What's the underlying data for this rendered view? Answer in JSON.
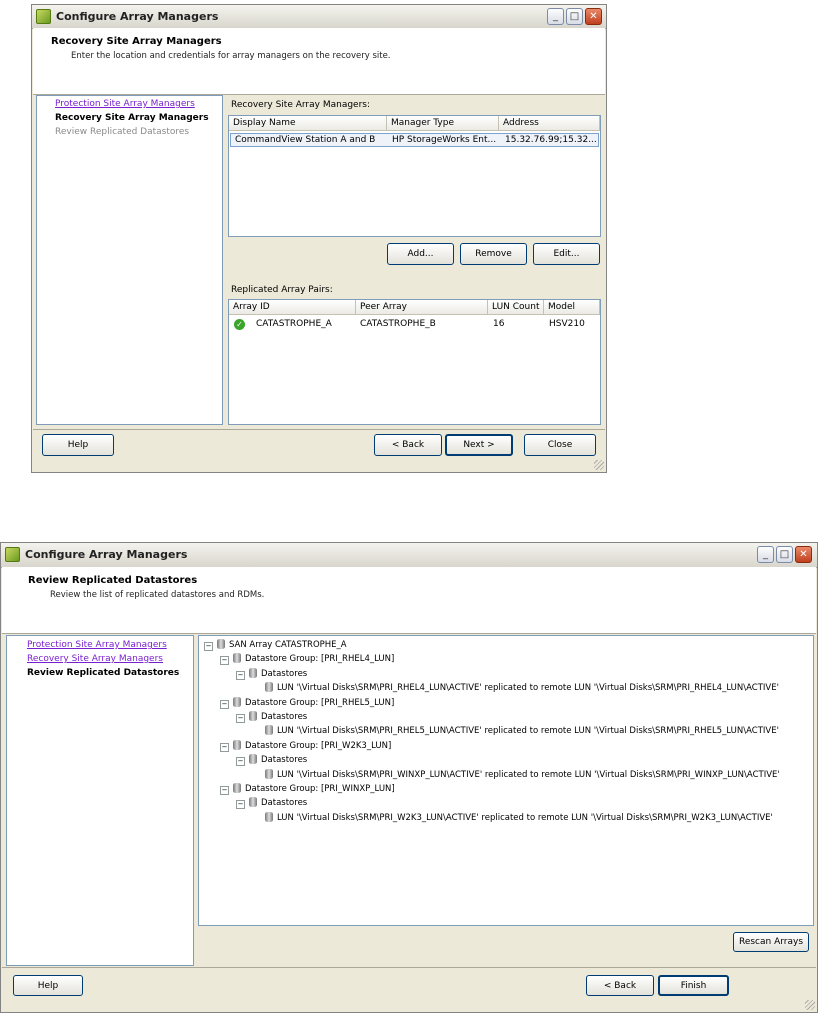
{
  "window1": {
    "title": "Configure Array Managers",
    "header_title": "Recovery Site Array Managers",
    "header_subtitle": "Enter the location and credentials for array managers on the recovery site.",
    "steps": [
      "Protection Site Array Managers",
      "Recovery Site Array Managers",
      "Review Replicated Datastores"
    ],
    "managers_label": "Recovery Site Array Managers:",
    "managers_columns": [
      "Display Name",
      "Manager Type",
      "Address"
    ],
    "managers_rows": [
      [
        "CommandView Station A and B",
        "HP StorageWorks Ent...",
        "15.32.76.99;15.32..."
      ]
    ],
    "add_label": "Add...",
    "remove_label": "Remove",
    "edit_label": "Edit...",
    "pairs_label": "Replicated Array Pairs:",
    "pairs_columns": [
      "Array ID",
      "Peer Array",
      "LUN Count",
      "Model"
    ],
    "pairs_rows": [
      [
        "CATASTROPHE_A",
        "CATASTROPHE_B",
        "16",
        "HSV210"
      ]
    ],
    "help_label": "Help",
    "back_label": "< Back",
    "next_label": "Next >",
    "close_label": "Close"
  },
  "window2": {
    "title": "Configure Array Managers",
    "header_title": "Review Replicated Datastores",
    "header_subtitle": "Review the list of replicated datastores and RDMs.",
    "steps": [
      "Protection Site Array Managers",
      "Recovery Site Array Managers",
      "Review Replicated Datastores"
    ],
    "tree": {
      "root": "SAN Array CATASTROPHE_A",
      "groups": [
        {
          "label": "Datastore Group: [PRI_RHEL4_LUN]",
          "child": "Datastores",
          "lun": "LUN '\\Virtual Disks\\SRM\\PRI_RHEL4_LUN\\ACTIVE' replicated to remote LUN '\\Virtual Disks\\SRM\\PRI_RHEL4_LUN\\ACTIVE'"
        },
        {
          "label": "Datastore Group: [PRI_RHEL5_LUN]",
          "child": "Datastores",
          "lun": "LUN '\\Virtual Disks\\SRM\\PRI_RHEL5_LUN\\ACTIVE' replicated to remote LUN '\\Virtual Disks\\SRM\\PRI_RHEL5_LUN\\ACTIVE'"
        },
        {
          "label": "Datastore Group: [PRI_W2K3_LUN]",
          "child": "Datastores",
          "lun": "LUN '\\Virtual Disks\\SRM\\PRI_WINXP_LUN\\ACTIVE' replicated to remote LUN '\\Virtual Disks\\SRM\\PRI_WINXP_LUN\\ACTIVE'"
        },
        {
          "label": "Datastore Group: [PRI_WINXP_LUN]",
          "child": "Datastores",
          "lun": "LUN '\\Virtual Disks\\SRM\\PRI_W2K3_LUN\\ACTIVE' replicated to remote LUN '\\Virtual Disks\\SRM\\PRI_W2K3_LUN\\ACTIVE'"
        }
      ]
    },
    "rescan_label": "Rescan Arrays",
    "help_label": "Help",
    "back_label": "< Back",
    "finish_label": "Finish"
  }
}
